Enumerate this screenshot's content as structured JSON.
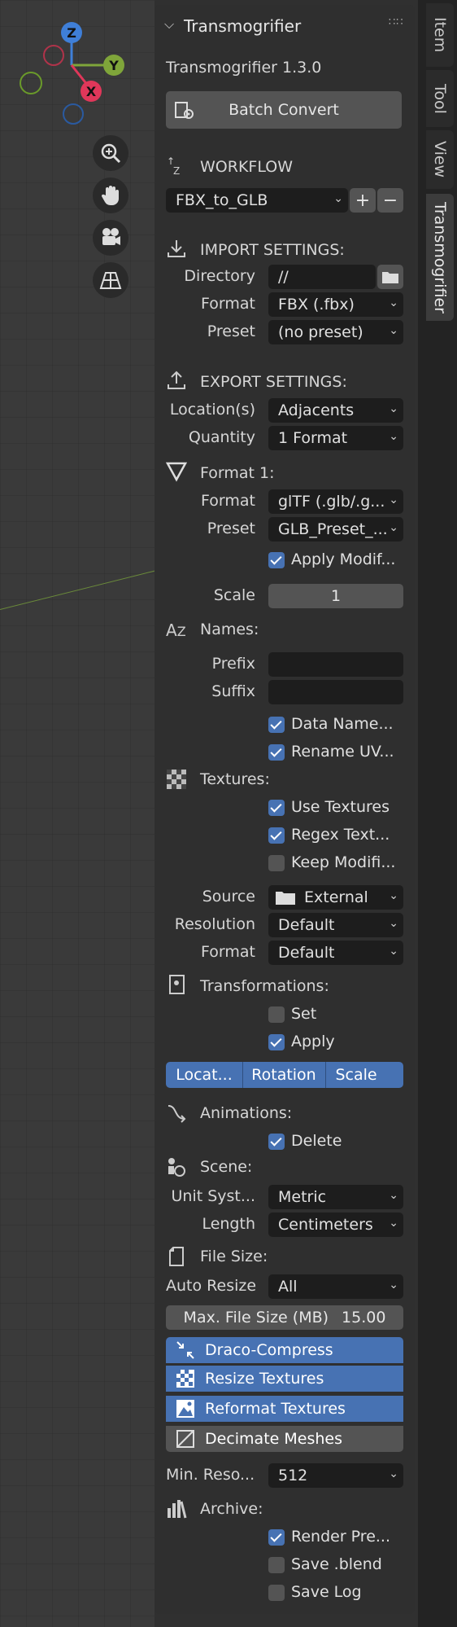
{
  "viewport": {
    "gizmo": {
      "x": "X",
      "y": "Y",
      "z": "Z"
    },
    "nav_icons": [
      "zoom-icon",
      "hand-pan-icon",
      "camera-icon",
      "perspective-grid-icon"
    ]
  },
  "panel": {
    "title": "Transmogrifier",
    "version": "Transmogrifier 1.3.0",
    "batch_convert": "Batch Convert",
    "workflow": {
      "header": "WORKFLOW",
      "value": "FBX_to_GLB",
      "add": "+",
      "remove": "−"
    },
    "import": {
      "header": "IMPORT SETTINGS:",
      "directory_label": "Directory",
      "directory_value": "//",
      "format_label": "Format",
      "format_value": "FBX (.fbx)",
      "preset_label": "Preset",
      "preset_value": "(no preset)"
    },
    "export": {
      "header": "EXPORT SETTINGS:",
      "locations_label": "Location(s)",
      "locations_value": "Adjacents",
      "quantity_label": "Quantity",
      "quantity_value": "1 Format"
    },
    "format1": {
      "header": "Format 1:",
      "format_label": "Format",
      "format_value": "glTF (.glb/.g...",
      "preset_label": "Preset",
      "preset_value": "GLB_Preset_...",
      "apply_modifiers": "Apply Modif...",
      "scale_label": "Scale",
      "scale_value": "1"
    },
    "names": {
      "header": "Names:",
      "prefix_label": "Prefix",
      "suffix_label": "Suffix",
      "data_names": "Data Name...",
      "rename_uv": "Rename UV..."
    },
    "textures": {
      "header": "Textures:",
      "use_textures": "Use Textures",
      "regex_textures": "Regex Text...",
      "keep_modified": "Keep Modifi...",
      "source_label": "Source",
      "source_value": "External",
      "resolution_label": "Resolution",
      "resolution_value": "Default",
      "format_label": "Format",
      "format_value": "Default"
    },
    "transformations": {
      "header": "Transformations:",
      "set": "Set",
      "apply": "Apply",
      "location": "Locat...",
      "rotation": "Rotation",
      "scale": "Scale"
    },
    "animations": {
      "header": "Animations:",
      "delete": "Delete"
    },
    "scene": {
      "header": "Scene:",
      "unit_label": "Unit Syst...",
      "unit_value": "Metric",
      "length_label": "Length",
      "length_value": "Centimeters"
    },
    "filesize": {
      "header": "File Size:",
      "auto_resize_label": "Auto Resize",
      "auto_resize_value": "All",
      "max_label": "Max. File Size (MB)",
      "max_value": "15.00",
      "draco": "Draco-Compress",
      "resize": "Resize Textures",
      "reformat": "Reformat Textures",
      "decimate": "Decimate Meshes",
      "min_res_label": "Min. Reso...",
      "min_res_value": "512"
    },
    "archive": {
      "header": "Archive:",
      "render_preview": "Render Pre...",
      "save_blend": "Save .blend",
      "save_log": "Save Log"
    }
  },
  "tabs": [
    "Item",
    "Tool",
    "View",
    "Transmogrifier"
  ],
  "colors": {
    "accent": "#4772b3",
    "panel": "#2f2f2f",
    "field": "#1d1d1d",
    "button": "#545454"
  }
}
